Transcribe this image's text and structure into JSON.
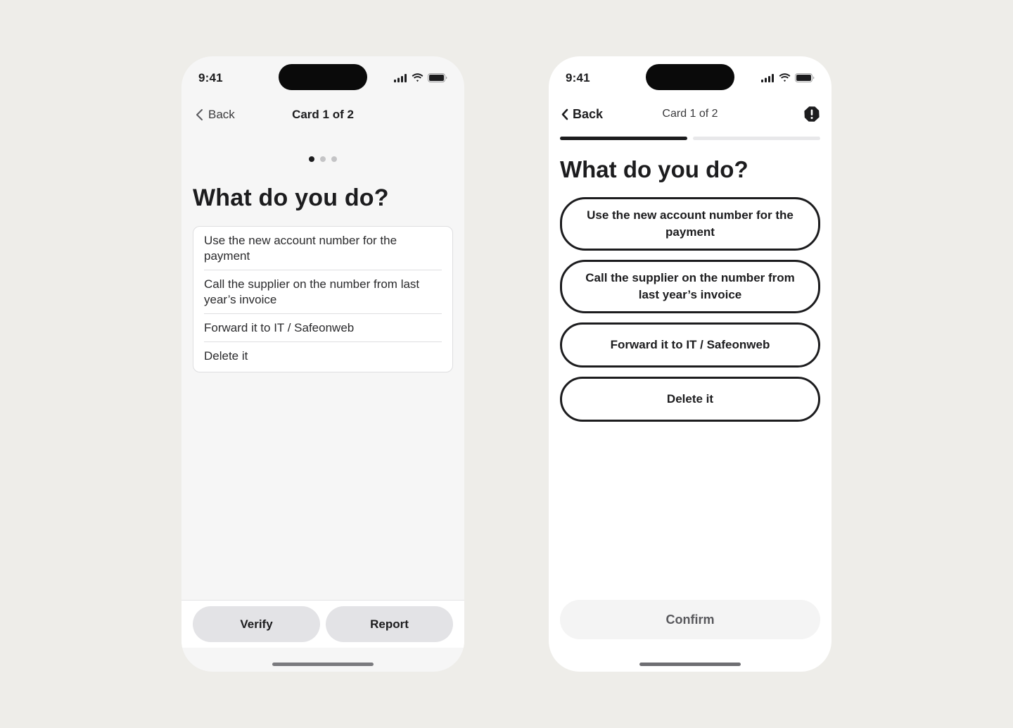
{
  "colors": {
    "background": "#eeede9",
    "text": "#1c1c1e",
    "secondary_button": "#e3e3e6",
    "disabled_button": "#f4f4f4"
  },
  "phone_a": {
    "status": {
      "time": "9:41"
    },
    "nav": {
      "back_label": "Back",
      "title": "Card 1 of 2"
    },
    "pager": {
      "count": 3,
      "active_index": 0
    },
    "heading": "What do you do?",
    "options": [
      "Use the new account number for the payment",
      "Call the supplier on the number from last year’s invoice",
      "Forward it to IT / Safeonweb",
      "Delete it"
    ],
    "buttons": {
      "verify": "Verify",
      "report": "Report"
    }
  },
  "phone_b": {
    "status": {
      "time": "9:41"
    },
    "nav": {
      "back_label": "Back",
      "title": "Card 1 of 2",
      "action_icon": "alert-icon"
    },
    "progress": {
      "current": 1,
      "total": 2
    },
    "heading": "What do you do?",
    "options": [
      "Use the new account number for the payment",
      "Call the supplier on the number from last year’s invoice",
      "Forward it to IT / Safeonweb",
      "Delete it"
    ],
    "confirm_label": "Confirm"
  }
}
